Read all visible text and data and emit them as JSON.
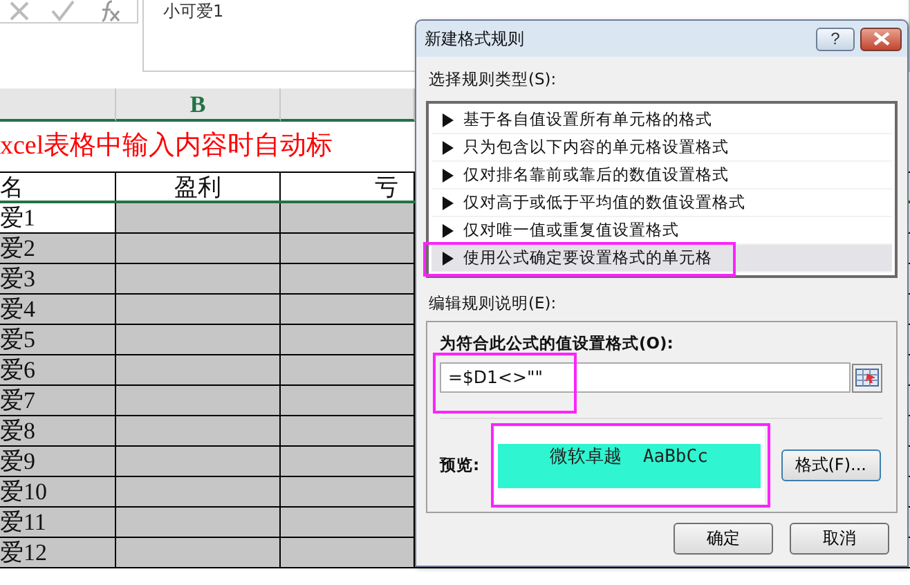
{
  "formula_bar": {
    "value": "小可爱1"
  },
  "sheet": {
    "column_headers": [
      "B"
    ],
    "title": "xcel表格中输入内容时自动标",
    "headers": [
      "名",
      "盈利",
      "亏"
    ],
    "rows": [
      {
        "name": "爱1",
        "filled": false
      },
      {
        "name": "爱2",
        "filled": true
      },
      {
        "name": "爱3",
        "filled": true
      },
      {
        "name": "爱4",
        "filled": true
      },
      {
        "name": "爱5",
        "filled": true
      },
      {
        "name": "爱6",
        "filled": true
      },
      {
        "name": "爱7",
        "filled": true
      },
      {
        "name": "爱8",
        "filled": true
      },
      {
        "name": "爱9",
        "filled": true
      },
      {
        "name": "爱10",
        "filled": true
      },
      {
        "name": "爱11",
        "filled": true
      },
      {
        "name": "爱12",
        "filled": true
      }
    ]
  },
  "dialog": {
    "title": "新建格式规则",
    "help": "?",
    "rule_type_label": "选择规则类型(S):",
    "rule_types": [
      {
        "label": "基于各自值设置所有单元格的格式",
        "selected": false,
        "highlighted": false
      },
      {
        "label": "只为包含以下内容的单元格设置格式",
        "selected": false,
        "highlighted": false
      },
      {
        "label": "仅对排名靠前或靠后的数值设置格式",
        "selected": false,
        "highlighted": false
      },
      {
        "label": "仅对高于或低于平均值的数值设置格式",
        "selected": false,
        "highlighted": false
      },
      {
        "label": "仅对唯一值或重复值设置格式",
        "selected": false,
        "highlighted": false
      },
      {
        "label": "使用公式确定要设置格式的单元格",
        "selected": true,
        "highlighted": true
      }
    ],
    "description_label": "编辑规则说明(E):",
    "formula_label": "为符合此公式的值设置格式(O):",
    "formula": {
      "value": "=$D1<>\"\"",
      "highlighted": true
    },
    "preview_label": "预览:",
    "preview": {
      "text": "微软卓越  AaBbCc",
      "color": "#2ff5d0",
      "highlighted": true
    },
    "format_button": "格式(F)...",
    "buttons": [
      "确定",
      "取消"
    ]
  }
}
